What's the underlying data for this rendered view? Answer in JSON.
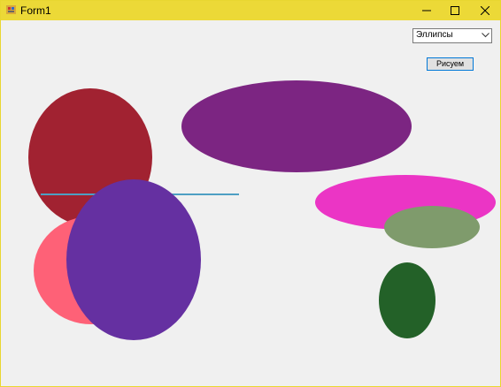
{
  "window": {
    "title": "Form1"
  },
  "controls": {
    "shape_select": {
      "value": "Эллипсы"
    },
    "draw_button": {
      "label": "Рисуем"
    }
  },
  "colors": {
    "title_bar": "#ecd937",
    "background": "#f0f0f0",
    "shapes": [
      "#a12231",
      "#fe6177",
      "#6530a1",
      "#7c2582",
      "#eb35c5",
      "#7f9b6c",
      "#236128",
      "#4e9fc3"
    ]
  },
  "icons": [
    "app-icon",
    "minimize-icon",
    "maximize-icon",
    "close-icon",
    "chevron-down-icon"
  ]
}
